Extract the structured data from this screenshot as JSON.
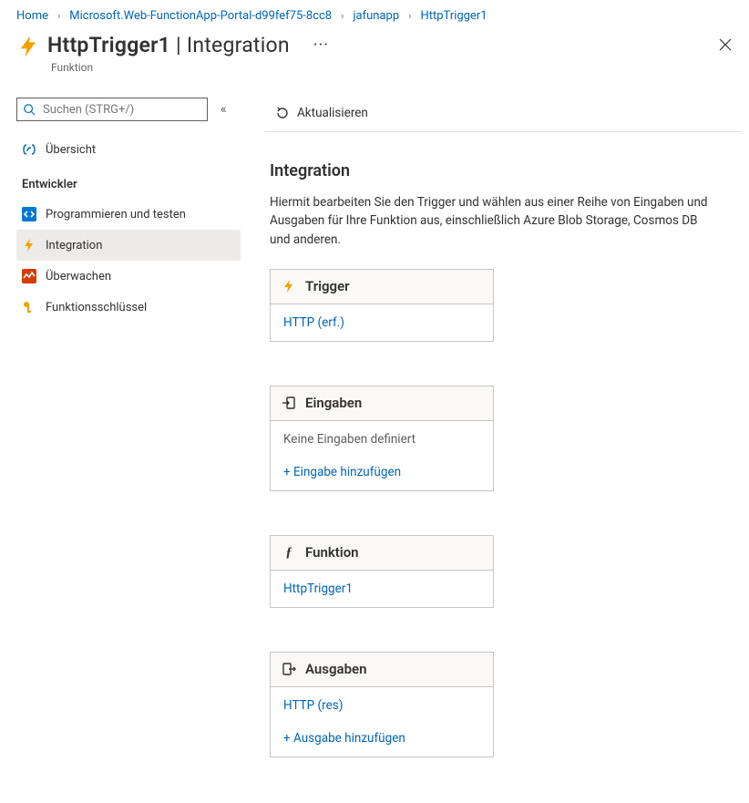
{
  "breadcrumb": [
    {
      "label": "Home"
    },
    {
      "label": "Microsoft.Web-FunctionApp-Portal-d99fef75-8cc8"
    },
    {
      "label": "jafunapp"
    },
    {
      "label": "HttpTrigger1"
    }
  ],
  "header": {
    "title": "HttpTrigger1",
    "subtitle": "Integration",
    "caption": "Funktion",
    "more": "···"
  },
  "search": {
    "placeholder": "Suchen (STRG+/)",
    "collapse_glyph": "«"
  },
  "nav": {
    "overview": "Übersicht",
    "group": "Entwickler",
    "code": "Programmieren und testen",
    "integration": "Integration",
    "monitor": "Überwachen",
    "keys": "Funktionsschlüssel"
  },
  "toolbar": {
    "refresh": "Aktualisieren"
  },
  "content": {
    "heading": "Integration",
    "description": "Hiermit bearbeiten Sie den Trigger und wählen aus einer Reihe von Eingaben und Ausgaben für Ihre Funktion aus, einschließlich Azure Blob Storage, Cosmos DB und anderen."
  },
  "cards": {
    "trigger": {
      "title": "Trigger",
      "items": [
        "HTTP (erf.)"
      ]
    },
    "inputs": {
      "title": "Eingaben",
      "empty": "Keine Eingaben definiert",
      "add": "+ Eingabe hinzufügen"
    },
    "function": {
      "title": "Funktion",
      "items": [
        "HttpTrigger1"
      ]
    },
    "outputs": {
      "title": "Ausgaben",
      "items": [
        "HTTP (res)"
      ],
      "add": "+ Ausgabe hinzufügen"
    }
  }
}
